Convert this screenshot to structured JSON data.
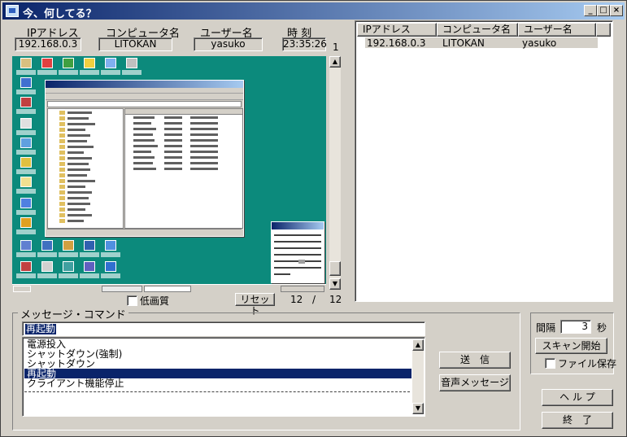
{
  "window": {
    "title": "今、何してる？"
  },
  "header": {
    "ip_label": "IPアドレス",
    "ip_value": "192.168.0.3",
    "computer_label": "コンピュータ名",
    "computer_value": "LITOKAN",
    "user_label": "ユーザー名",
    "user_value": "yasuko",
    "time_label": "時 刻",
    "time_value": "23:35:26",
    "page_indicator": "1"
  },
  "preview": {
    "low_quality_label": "低画質",
    "reset_button": "リセット",
    "counter_current": "12",
    "counter_sep": "/",
    "counter_total": "12"
  },
  "client_list": {
    "columns": [
      "IPアドレス",
      "コンピュータ名",
      "ユーザー名"
    ],
    "rows": [
      {
        "ip": "192.168.0.3",
        "computer": "LITOKAN",
        "user": "yasuko"
      }
    ]
  },
  "message": {
    "group_label": "メッセージ・コマンド",
    "input_value": "再起動",
    "commands": [
      "電源投入",
      "シャットダウン(強制)",
      "シャットダウン",
      "再起動",
      "クライアント機能停止"
    ],
    "selected_index": 3,
    "send_button": "送　信",
    "voice_button": "音声メッセージ"
  },
  "scan": {
    "interval_label": "間隔",
    "interval_value": "3",
    "interval_unit": "秒",
    "scan_button": "スキャン開始",
    "save_file_label": "ファイル保存"
  },
  "footer": {
    "help_button": "ヘ ル プ",
    "exit_button": "終　了"
  },
  "colors": {
    "title_start": "#0a246a",
    "title_end": "#a6caf0",
    "desktop": "#0c8a7c",
    "selection": "#0a246a"
  }
}
